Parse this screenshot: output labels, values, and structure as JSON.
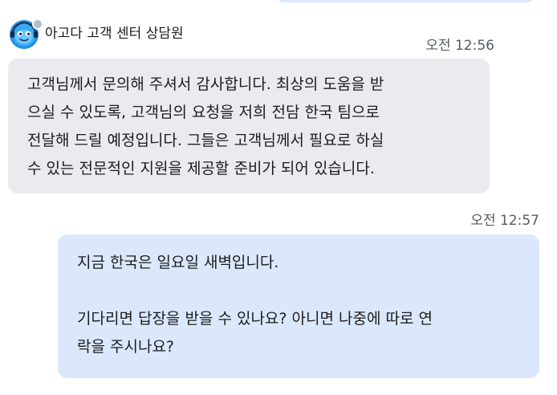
{
  "agent": {
    "name": "아고다 고객 센터 상담원",
    "avatar_icon": "blue-agent-mascot-icon",
    "status_color": "#b8bcc6"
  },
  "messages": [
    {
      "sender": "agent",
      "time": "오전 12:56",
      "lines": [
        "고객님께서 문의해 주셔서 감사합니다. 최상의 도움을 받",
        "으실 수 있도록, 고객님의 요청을 저희 전담 한국 팀으로",
        "전달해 드릴 예정입니다. 그들은 고객님께서 필요로 하실",
        "수 있는 전문적인 지원을 제공할 준비가 되어 있습니다."
      ],
      "bubble_color": "#ebeaee"
    },
    {
      "sender": "user",
      "time": "오전 12:57",
      "paragraph1": [
        "지금 한국은 일요일 새벽입니다."
      ],
      "paragraph2": [
        "기다리면 답장을 받을 수 있나요? 아니면 나중에 따로 연",
        "락을 주시나요?"
      ],
      "bubble_color": "#dbe8fb"
    }
  ]
}
